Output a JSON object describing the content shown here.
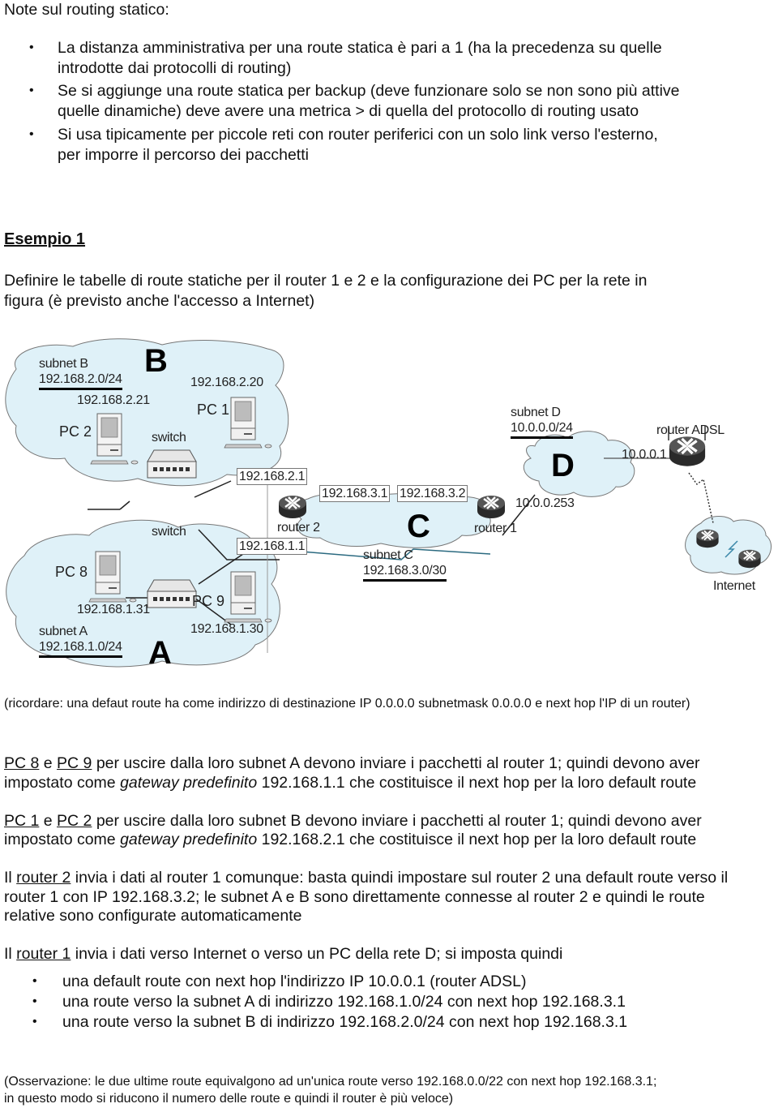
{
  "notes": {
    "title": "Note sul routing statico:",
    "bullets": [
      {
        "line1": "La distanza amministrativa per una route statica è pari a 1 (ha la precedenza su quelle",
        "line2": "introdotte dai protocolli di routing)"
      },
      {
        "line1": "Se si aggiunge una route statica per backup (deve funzionare solo se non sono più attive",
        "line2": "quelle dinamiche) deve avere una metrica > di quella del protocollo di routing usato"
      },
      {
        "line1": "Si usa tipicamente per piccole reti con router periferici con un solo link verso l'esterno,",
        "line2": "per imporre il percorso dei pacchetti"
      }
    ]
  },
  "example": {
    "heading": "Esempio 1",
    "intro_line1": "Definire le tabelle di route statiche per il router 1 e 2 e la configurazione dei PC per la rete in",
    "intro_line2": "figura (è previsto anche l'accesso a Internet)"
  },
  "diagram": {
    "subnet_b": {
      "letter": "B",
      "label": "subnet B",
      "ip": "192.168.2.0/24"
    },
    "subnet_a": {
      "letter": "A",
      "label": "subnet A",
      "ip": "192.168.1.0/24"
    },
    "subnet_c": {
      "letter": "C",
      "label": "subnet C",
      "ip": "192.168.3.0/30"
    },
    "subnet_d": {
      "letter": "D",
      "label": "subnet D",
      "ip": "10.0.0.0/24"
    },
    "pc1": {
      "name": "PC 1",
      "ip": "192.168.2.20"
    },
    "pc2": {
      "name": "PC 2",
      "ip": "192.168.2.21"
    },
    "pc8": {
      "name": "PC 8",
      "ip": "192.168.1.31"
    },
    "pc9": {
      "name": "PC 9",
      "ip": "192.168.1.30"
    },
    "switch_b": "switch",
    "switch_a": "switch",
    "router2": {
      "name": "router 2",
      "ip_b": "192.168.2.1",
      "ip_a": "192.168.1.1",
      "ip_c": "192.168.3.1"
    },
    "router1": {
      "name": "router 1",
      "ip_c": "192.168.3.2",
      "ip_d": "10.0.0.253"
    },
    "router_adsl": {
      "name": "router ADSL",
      "ip": "10.0.0.1"
    },
    "internet": "Internet"
  },
  "reminder": "(ricordare: una defaut route ha come indirizzo di destinazione IP 0.0.0.0 subnetmask 0.0.0.0 e next hop l'IP di un router)",
  "para_a": {
    "pc_a": "PC 8",
    "e": " e ",
    "pc_b": "PC 9",
    "rest1": " per uscire dalla loro subnet A devono inviare i pacchetti al router 1; quindi devono aver",
    "line2_pre": "impostato come ",
    "line2_em": "gateway predefinito",
    "line2_post": " 192.168.1.1 che costituisce il next hop per la loro default route"
  },
  "para_b": {
    "pc_a": "PC 1",
    "e": " e ",
    "pc_b": "PC 2",
    "rest1": " per uscire dalla loro subnet B devono inviare i pacchetti al router 1; quindi devono aver",
    "line2_pre": "impostato come ",
    "line2_em": "gateway predefinito",
    "line2_post": " 192.168.2.1 che costituisce il next hop per la loro default route"
  },
  "para_router2": {
    "pre": "Il ",
    "link": "router 2",
    "rest1": " invia i dati al router 1 comunque: basta quindi impostare sul router 2 una default route verso il",
    "line2": "router 1 con IP 192.168.3.2; le subnet  A e B sono direttamente connesse al router 2 e quindi le route",
    "line3": "relative sono configurate automaticamente"
  },
  "para_router1": {
    "pre": "Il ",
    "link": "router 1",
    "rest1": " invia i dati verso Internet o verso un PC della rete D; si imposta quindi",
    "bullets": [
      "una default route con next hop l'indirizzo IP 10.0.0.1 (router ADSL)",
      "una route verso la subnet A  di indirizzo 192.168.1.0/24 con next hop 192.168.3.1",
      "una route verso la subnet B  di indirizzo 192.168.2.0/24 con next hop 192.168.3.1"
    ]
  },
  "observation": {
    "line1": "(Osservazione: le due ultime route equivalgono ad un'unica route verso 192.168.0.0/22 con next hop 192.168.3.1;",
    "line2": "in questo modo si riducono il numero delle route e quindi il router è più veloce)"
  }
}
